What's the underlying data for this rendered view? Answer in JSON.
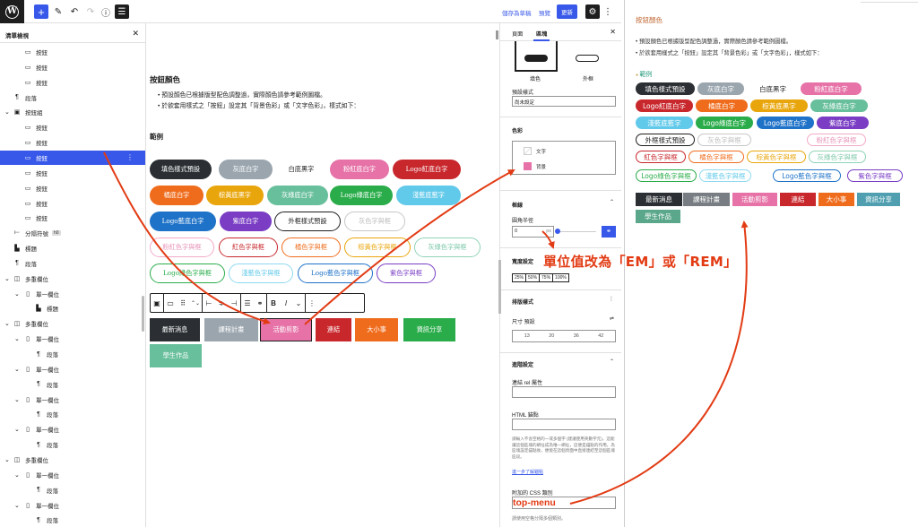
{
  "topbar": {
    "logo": "W",
    "add_icon": "+",
    "save_draft": "儲存為草稿",
    "preview": "預覽",
    "update": "更新"
  },
  "listview": {
    "title": "清單檢視",
    "rows": [
      {
        "label": "按鈕",
        "icon": "button-icon"
      },
      {
        "label": "按鈕",
        "icon": "button-icon"
      },
      {
        "label": "按鈕",
        "icon": "button-icon"
      },
      {
        "label": "段落",
        "icon": "paragraph-icon"
      },
      {
        "label": "按鈕組",
        "icon": "buttons-icon"
      },
      {
        "label": "按鈕",
        "icon": "button-icon"
      },
      {
        "label": "按鈕",
        "icon": "button-icon"
      },
      {
        "label": "按鈕",
        "icon": "button-icon",
        "selected": true
      },
      {
        "label": "按鈕",
        "icon": "button-icon"
      },
      {
        "label": "按鈕",
        "icon": "button-icon"
      },
      {
        "label": "按鈕",
        "icon": "button-icon"
      },
      {
        "label": "按鈕",
        "icon": "button-icon"
      },
      {
        "label": "分隔符號",
        "icon": "separator-icon",
        "badge": "h0"
      },
      {
        "label": "標題",
        "icon": "heading-icon"
      },
      {
        "label": "段落",
        "icon": "paragraph-icon"
      },
      {
        "label": "多重欄位",
        "icon": "columns-icon"
      },
      {
        "label": "單一欄位",
        "icon": "column-icon"
      },
      {
        "label": "標題",
        "icon": "heading-icon"
      },
      {
        "label": "多重欄位",
        "icon": "columns-icon"
      },
      {
        "label": "單一欄位",
        "icon": "column-icon"
      },
      {
        "label": "段落",
        "icon": "paragraph-icon"
      },
      {
        "label": "單一欄位",
        "icon": "column-icon"
      },
      {
        "label": "段落",
        "icon": "paragraph-icon"
      },
      {
        "label": "單一欄位",
        "icon": "column-icon"
      },
      {
        "label": "段落",
        "icon": "paragraph-icon"
      },
      {
        "label": "單一欄位",
        "icon": "column-icon"
      },
      {
        "label": "段落",
        "icon": "paragraph-icon"
      },
      {
        "label": "多重欄位",
        "icon": "columns-icon"
      },
      {
        "label": "單一欄位",
        "icon": "column-icon"
      },
      {
        "label": "段落",
        "icon": "paragraph-icon"
      },
      {
        "label": "單一欄位",
        "icon": "column-icon"
      },
      {
        "label": "段落",
        "icon": "paragraph-icon"
      }
    ]
  },
  "editor": {
    "title": "按鈕顏色",
    "bullets": [
      "預設顏色已根據版型配色調整過，實際顏色請參考範例圖檔。",
      "於欲套用樣式之「按鈕」設定其「背景色彩」或「文字色彩」，樣式如下："
    ],
    "example_label": "範例",
    "pills": [
      {
        "label": "填色樣式預設",
        "bg": "#2b2f33",
        "fg": "#ffffff"
      },
      {
        "label": "灰底白字",
        "bg": "#9aa5ae",
        "fg": "#ffffff"
      },
      {
        "label": "白底黑字",
        "bg": "#ffffff",
        "fg": "#1e1e1e"
      },
      {
        "label": "粉紅底白字",
        "bg": "#e672a7",
        "fg": "#ffffff"
      },
      {
        "label": "Logo紅底白字",
        "bg": "#c8272c",
        "fg": "#ffffff"
      },
      {
        "label": "橘底白字",
        "bg": "#ef6c1c",
        "fg": "#ffffff"
      },
      {
        "label": "棕黃底黑字",
        "bg": "#e9a60c",
        "fg": "#ffffff"
      },
      {
        "label": "灰綠底白字",
        "bg": "#67bf9c",
        "fg": "#ffffff"
      },
      {
        "label": "Logo綠底白字",
        "bg": "#2aac4a",
        "fg": "#ffffff"
      },
      {
        "label": "淺藍底藍字",
        "bg": "#61c9ea",
        "fg": "#ffffff"
      },
      {
        "label": "Logo藍底白字",
        "bg": "#1e72c8",
        "fg": "#ffffff"
      },
      {
        "label": "紫底白字",
        "bg": "#7a3dc4",
        "fg": "#ffffff"
      },
      {
        "label": "外框樣式預設",
        "border": "#1e1e1e",
        "fg": "#1e1e1e"
      },
      {
        "label": "灰色字與框",
        "border": "#c7c7c7",
        "fg": "#bdbdbd"
      },
      {
        "label": "粉紅色字與框",
        "border": "#f2a9c7",
        "fg": "#e794b8"
      },
      {
        "label": "紅色字與框",
        "border": "#c8272c",
        "fg": "#c8272c"
      },
      {
        "label": "橘色字與框",
        "border": "#ef6c1c",
        "fg": "#ef6c1c"
      },
      {
        "label": "棕黃色字與框",
        "border": "#e9a60c",
        "fg": "#e9a60c"
      },
      {
        "label": "灰綠色字與框",
        "border": "#8ed3b6",
        "fg": "#7cc8a9"
      },
      {
        "label": "Logo綠色字與框",
        "border": "#2aac4a",
        "fg": "#2aac4a"
      },
      {
        "label": "淺藍色字與框",
        "border": "#8fd9f0",
        "fg": "#61c9ea"
      },
      {
        "label": "Logo藍色字與框",
        "border": "#1e72c8",
        "fg": "#1e72c8"
      },
      {
        "label": "紫色字與框",
        "border": "#7a3dc4",
        "fg": "#7a3dc4"
      }
    ],
    "squares": [
      {
        "label": "最新消息",
        "bg": "#2b2f33"
      },
      {
        "label": "課程計畫",
        "bg": "#9aa5ae"
      },
      {
        "label": "活動剪影",
        "bg": "#e672a7"
      },
      {
        "label": "連結",
        "bg": "#c8272c"
      },
      {
        "label": "大小事",
        "bg": "#ef6c1c"
      },
      {
        "label": "資訊分享",
        "bg": "#2aac4a"
      },
      {
        "label": "學生作品",
        "bg": "#67bf9c"
      }
    ],
    "toolbar_icons": [
      "buttons-icon",
      "button-icon",
      "drag-icon",
      "chevrons-icon",
      "justify-left-icon",
      "justify-center-icon",
      "justify-right-icon",
      "link-icon",
      "bold-icon",
      "italic-icon",
      "chevron-down-icon",
      "more-icon"
    ]
  },
  "sidebar": {
    "tab_page": "頁面",
    "tab_block": "區塊",
    "style_fill": "填色",
    "style_outline": "外框",
    "default_style_label": "預設樣式",
    "default_style_value": "尚未設定",
    "color_section": "色彩",
    "color_text": "文字",
    "color_background": "背景",
    "border_section": "框線",
    "radius_label": "圓角半徑",
    "radius_value": "0",
    "radius_unit": "px",
    "width_label": "寬度設定",
    "width_options": [
      "25%",
      "50%",
      "75%",
      "100%"
    ],
    "typography_section": "排版樣式",
    "size_label": "尺寸 預設",
    "sizes": [
      "13",
      "20",
      "36",
      "42"
    ],
    "advanced_section": "進階設定",
    "rel_label": "連結 rel 屬性",
    "anchor_label": "HTML 錨點",
    "anchor_help": "請輸入不含空格的一或多個字 (建議使用英數字元)，這能讓這個區塊的網址成為唯一網址，這便是錨點的作用。為區塊設定錨點後，便能在這個頁面中直接連結至這個區塊區段。",
    "anchor_more": "進一步了解錨點",
    "css_label": "附加的 CSS 類別",
    "css_value": "top-menu",
    "css_help": "請使用空格分隔多個類別。"
  },
  "annotation": {
    "units": "單位值改為「EM」或「REM」"
  },
  "preview_pane": {
    "title": "按鈕顏色",
    "bullets": [
      "預設顏色已根據版型配色調整過，實際顏色請參考範例圖檔。",
      "於欲套用樣式之「按鈕」設定其「背景色彩」或「文字色彩」，樣式如下："
    ],
    "example_label": "範例",
    "accent_title": "#c06a35",
    "accent_example": "#2a9d7e"
  }
}
